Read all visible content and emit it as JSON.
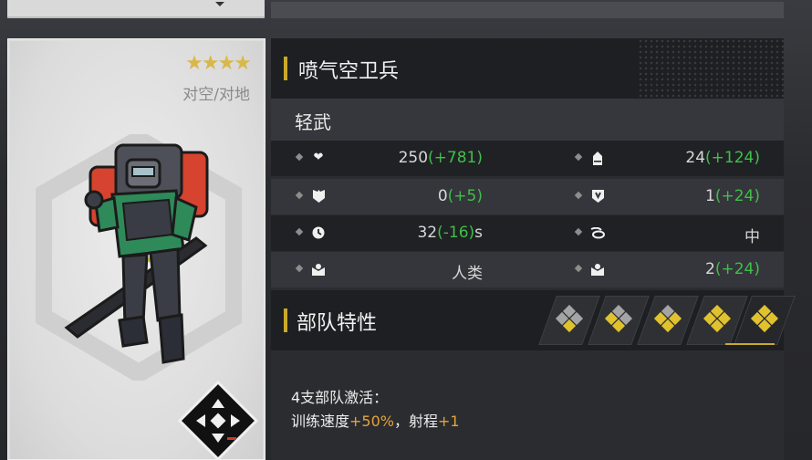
{
  "unit": {
    "name": "喷气空卫兵",
    "stars": "★★★★",
    "role": "对空/对地",
    "class": "轻武"
  },
  "stats": [
    {
      "left": {
        "icon": "heart-icon",
        "base": "250",
        "bonus": "(+781)",
        "unit": ""
      },
      "right": {
        "icon": "ammo-icon",
        "base": "24",
        "bonus": "(+124)",
        "unit": ""
      }
    },
    {
      "left": {
        "icon": "shield-icon",
        "base": "0",
        "bonus": "(+5)",
        "unit": ""
      },
      "right": {
        "icon": "armor-icon",
        "base": "1",
        "bonus": "(+24)",
        "unit": ""
      }
    },
    {
      "left": {
        "icon": "clock-icon",
        "base": "32",
        "bonus": "(-16)",
        "unit": "s"
      },
      "right": {
        "icon": "speed-icon",
        "base": "",
        "bonus": "中",
        "unit": ""
      }
    },
    {
      "left": {
        "icon": "unit-type-icon",
        "base": "人类",
        "bonus": "",
        "unit": ""
      },
      "right": {
        "icon": "population-icon",
        "base": "2",
        "bonus": "(+24)",
        "unit": ""
      }
    }
  ],
  "traits": {
    "title": "部队特性",
    "tiers": [
      {
        "name": "tier-1",
        "active_count": 1
      },
      {
        "name": "tier-2",
        "active_count": 2
      },
      {
        "name": "tier-3",
        "active_count": 3
      },
      {
        "name": "tier-4",
        "active_count": 4
      },
      {
        "name": "tier-5",
        "active_count": 4
      }
    ],
    "selected_tier": 5,
    "desc_line1": "4支部队激活：",
    "desc_line2_prefix": "训练速度",
    "desc_line2_speed": "+50%",
    "desc_line2_mid": "，射程",
    "desc_line2_range": "+1"
  },
  "colors": {
    "accent": "#c9a92a",
    "bonus_green": "#3fbf4a",
    "highlight_orange": "#e2a43a",
    "star_gold": "#d8b84a"
  }
}
